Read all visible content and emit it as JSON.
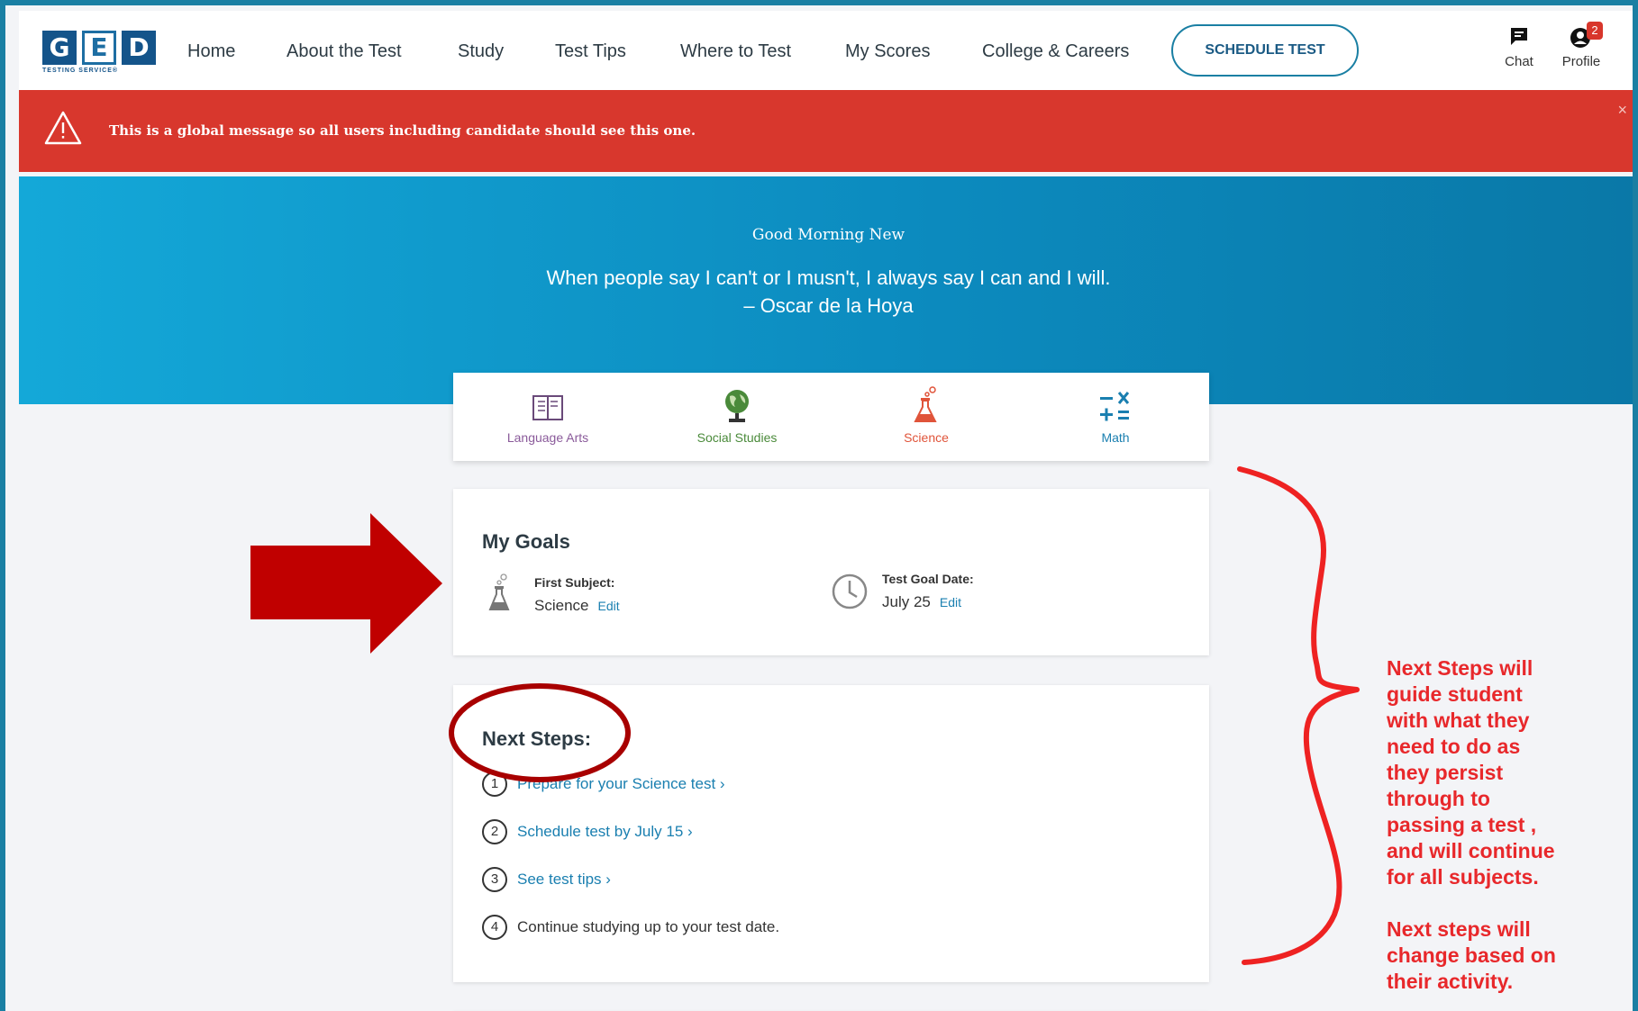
{
  "nav": {
    "logo": {
      "letters": [
        "G",
        "E",
        "D"
      ],
      "tagline": "TESTING SERVICE®"
    },
    "links": [
      "Home",
      "About the Test",
      "Study",
      "Test Tips",
      "Where to Test",
      "My Scores",
      "College & Careers"
    ],
    "schedule_button": "SCHEDULE TEST",
    "chat_label": "Chat",
    "profile_label": "Profile",
    "profile_badge": "2"
  },
  "alert": {
    "message": "This is a global message so all users including candidate should see this one.",
    "close": "×",
    "color": "#d8372d"
  },
  "hero": {
    "greeting": "Good Morning New",
    "quote_line1": "When people say I can't or I musn't, I always say I can and I will.",
    "quote_line2": "– Oscar de la Hoya"
  },
  "subjects": [
    {
      "label": "Language Arts",
      "icon": "book-icon",
      "color": "#8a5a9a"
    },
    {
      "label": "Social Studies",
      "icon": "globe-icon",
      "color": "#4a8a3a"
    },
    {
      "label": "Science",
      "icon": "flask-icon",
      "color": "#e0543a"
    },
    {
      "label": "Math",
      "icon": "math-operators-icon",
      "color": "#1a7fb0"
    }
  ],
  "goals": {
    "title": "My Goals",
    "first_subject_label": "First Subject:",
    "first_subject_value": "Science",
    "test_goal_label": "Test Goal Date:",
    "test_goal_value": "July 25",
    "edit_label": "Edit"
  },
  "next_steps": {
    "title": "Next Steps:",
    "steps": [
      {
        "num": "1",
        "text": "Prepare for your Science test ›"
      },
      {
        "num": "2",
        "text": "Schedule test by July 15 ›"
      },
      {
        "num": "3",
        "text": "See test tips ›"
      },
      {
        "num": "4",
        "text": "Continue studying up to your test date."
      }
    ]
  },
  "annotation": {
    "lines_block1": [
      "Next Steps will",
      "guide student",
      "with what they",
      "need to do as",
      "they persist",
      "through to",
      "passing a test ,",
      "and will continue",
      "for all subjects."
    ],
    "lines_block2": [
      "Next steps will",
      "change based on",
      "their activity."
    ],
    "color": "#e8282b",
    "arrow_color": "#c00000"
  }
}
